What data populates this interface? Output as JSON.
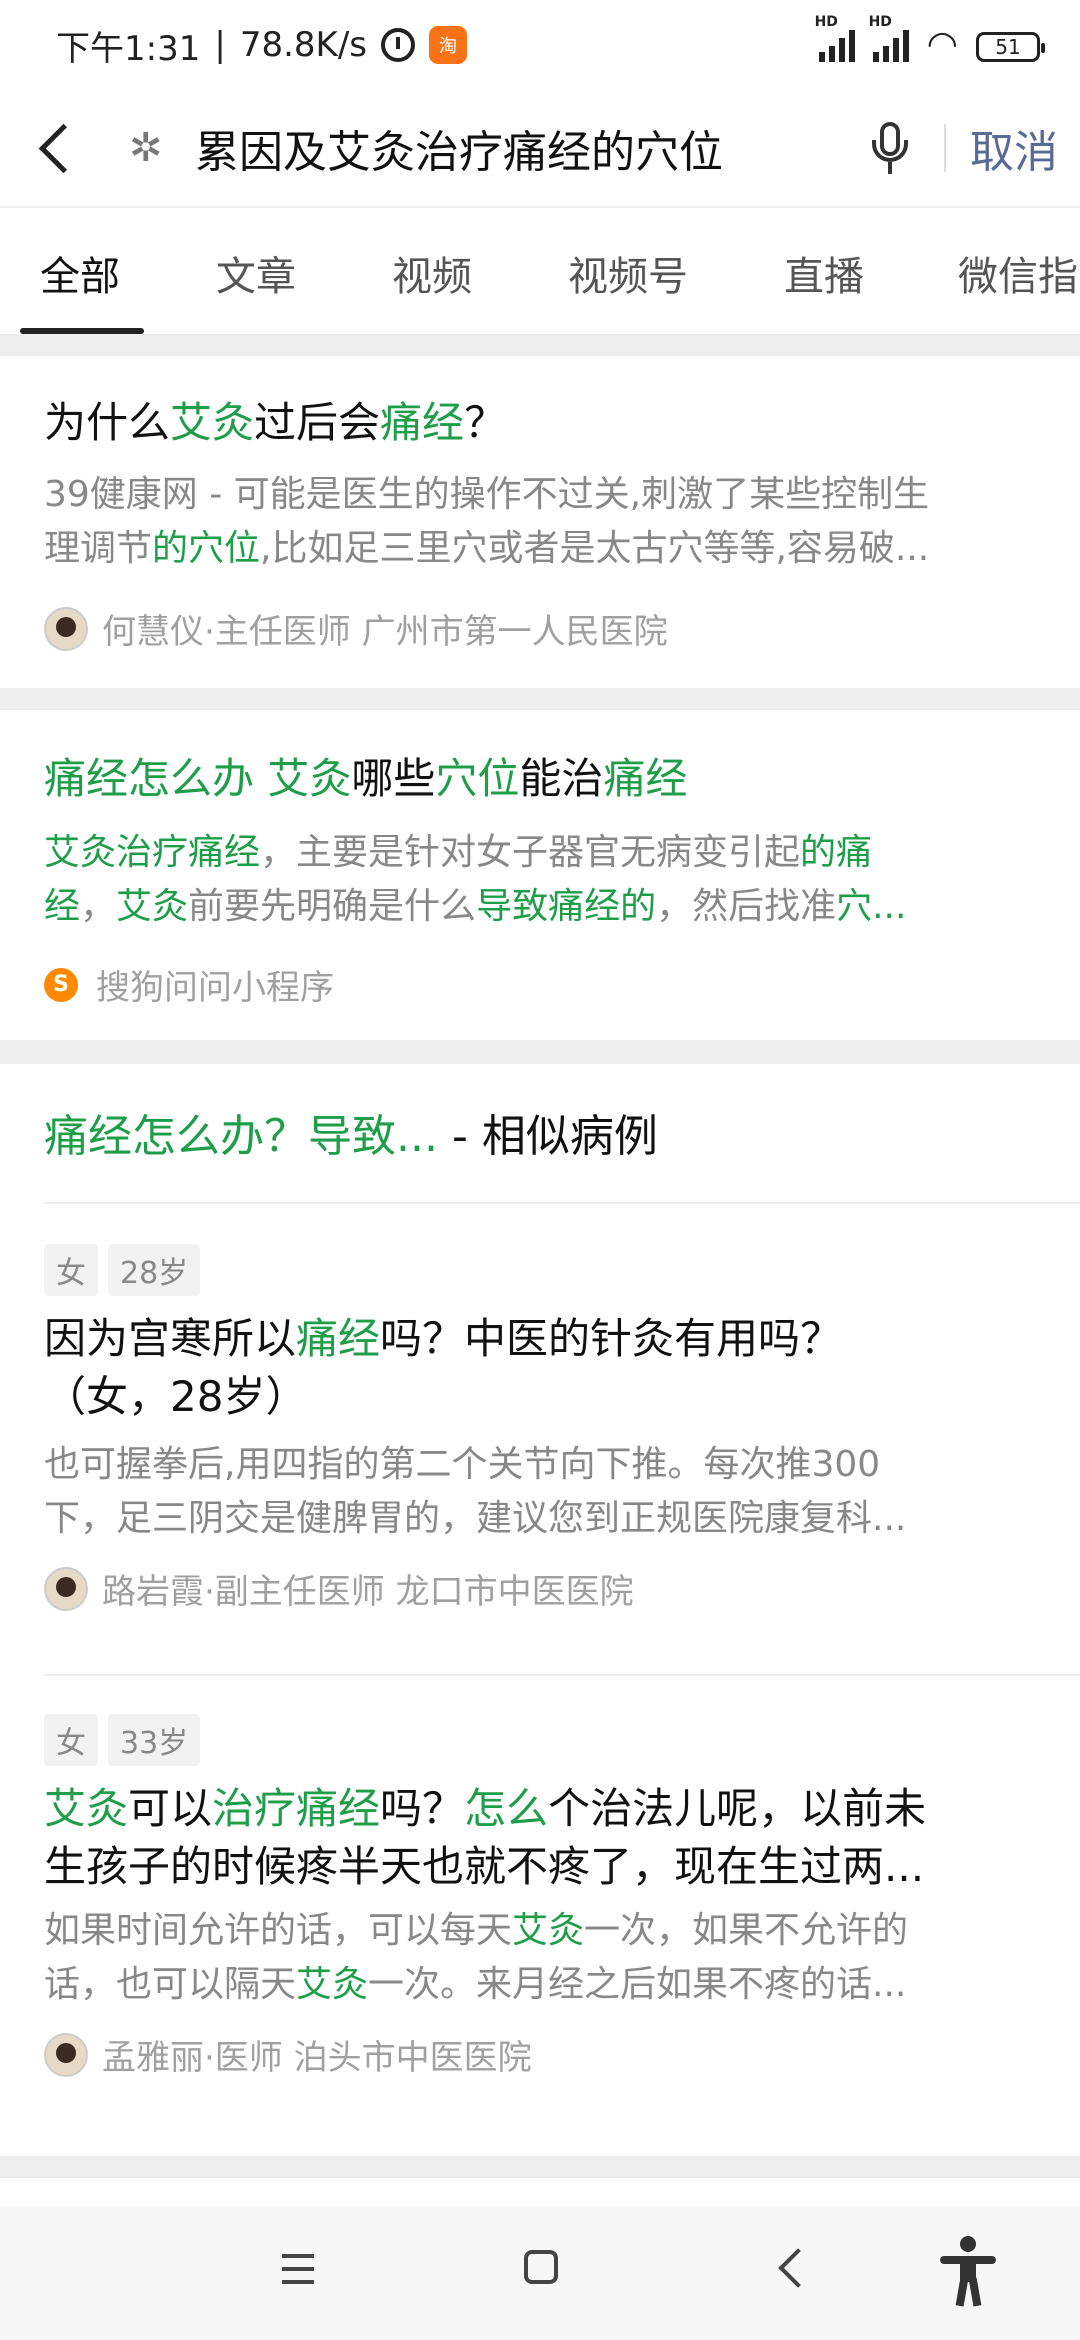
{
  "status_bar": {
    "time": "下午1:31",
    "net_speed": "78.8K/s",
    "badge_text": "淘",
    "hd1": "HD",
    "hd2": "HD",
    "battery": "51"
  },
  "search": {
    "query": "累因及艾灸治疗痛经的穴位",
    "cancel_label": "取消"
  },
  "tabs": [
    "全部",
    "文章",
    "视频",
    "视频号",
    "直播",
    "微信指"
  ],
  "results": [
    {
      "title_parts": [
        "为什么",
        "艾灸",
        "过后会",
        "痛经",
        "？"
      ],
      "snippet_line1": "39健康网 - 可能是医生的操作不过关,刺激了某些控制生",
      "snippet_line2_parts": [
        "理调节",
        "的穴位",
        ",比如足三里穴或者是太古穴等等,容易破..."
      ],
      "source": "何慧仪·主任医师  广州市第一人民医院"
    },
    {
      "title_parts": [
        "痛经怎么办 艾灸",
        "哪些",
        "穴位",
        "能治",
        "痛经"
      ],
      "snippet_line1_parts": [
        "艾灸治疗痛经",
        "，主要是针对女子器官无病变引起",
        "的痛"
      ],
      "snippet_line2_parts": [
        "经",
        "，",
        "艾灸",
        "前要先明确是什么",
        "导致痛经的",
        "，然后找准",
        "穴..."
      ],
      "source": "搜狗问问小程序",
      "source_icon": "S"
    }
  ],
  "cases": {
    "header_parts": [
      "痛经怎么办？导致...",
      " - 相似病例"
    ],
    "items": [
      {
        "tags": [
          "女",
          "28岁"
        ],
        "question_line1_parts": [
          "因为宫寒所以",
          "痛经",
          "吗？中医的针灸有用吗？"
        ],
        "question_line2": "（女，28岁）",
        "answer_line1": "也可握拳后,用四指的第二个关节向下推。每次推300",
        "answer_line2": "下，足三阴交是健脾胃的，建议您到正规医院康复科...",
        "doctor": "路岩霞·副主任医师  龙口市中医医院"
      },
      {
        "tags": [
          "女",
          "33岁"
        ],
        "question_line1_parts": [
          "艾灸",
          "可以",
          "治疗痛经",
          "吗？",
          "怎么",
          "个治法儿呢，以前未"
        ],
        "question_line2": "生孩子的时候疼半天也就不疼了，现在生过两...",
        "answer_line1_parts": [
          "如果时间允许的话，可以每天",
          "艾灸",
          "一次，如果不允许的"
        ],
        "answer_line2_parts": [
          "话，也可以隔天",
          "艾灸",
          "一次。来月经之后如果不疼的话..."
        ],
        "doctor": "孟雅丽·医师  泊头市中医医院"
      }
    ]
  },
  "colors": {
    "highlight": "#1f9e4a",
    "cancel": "#576b95"
  }
}
